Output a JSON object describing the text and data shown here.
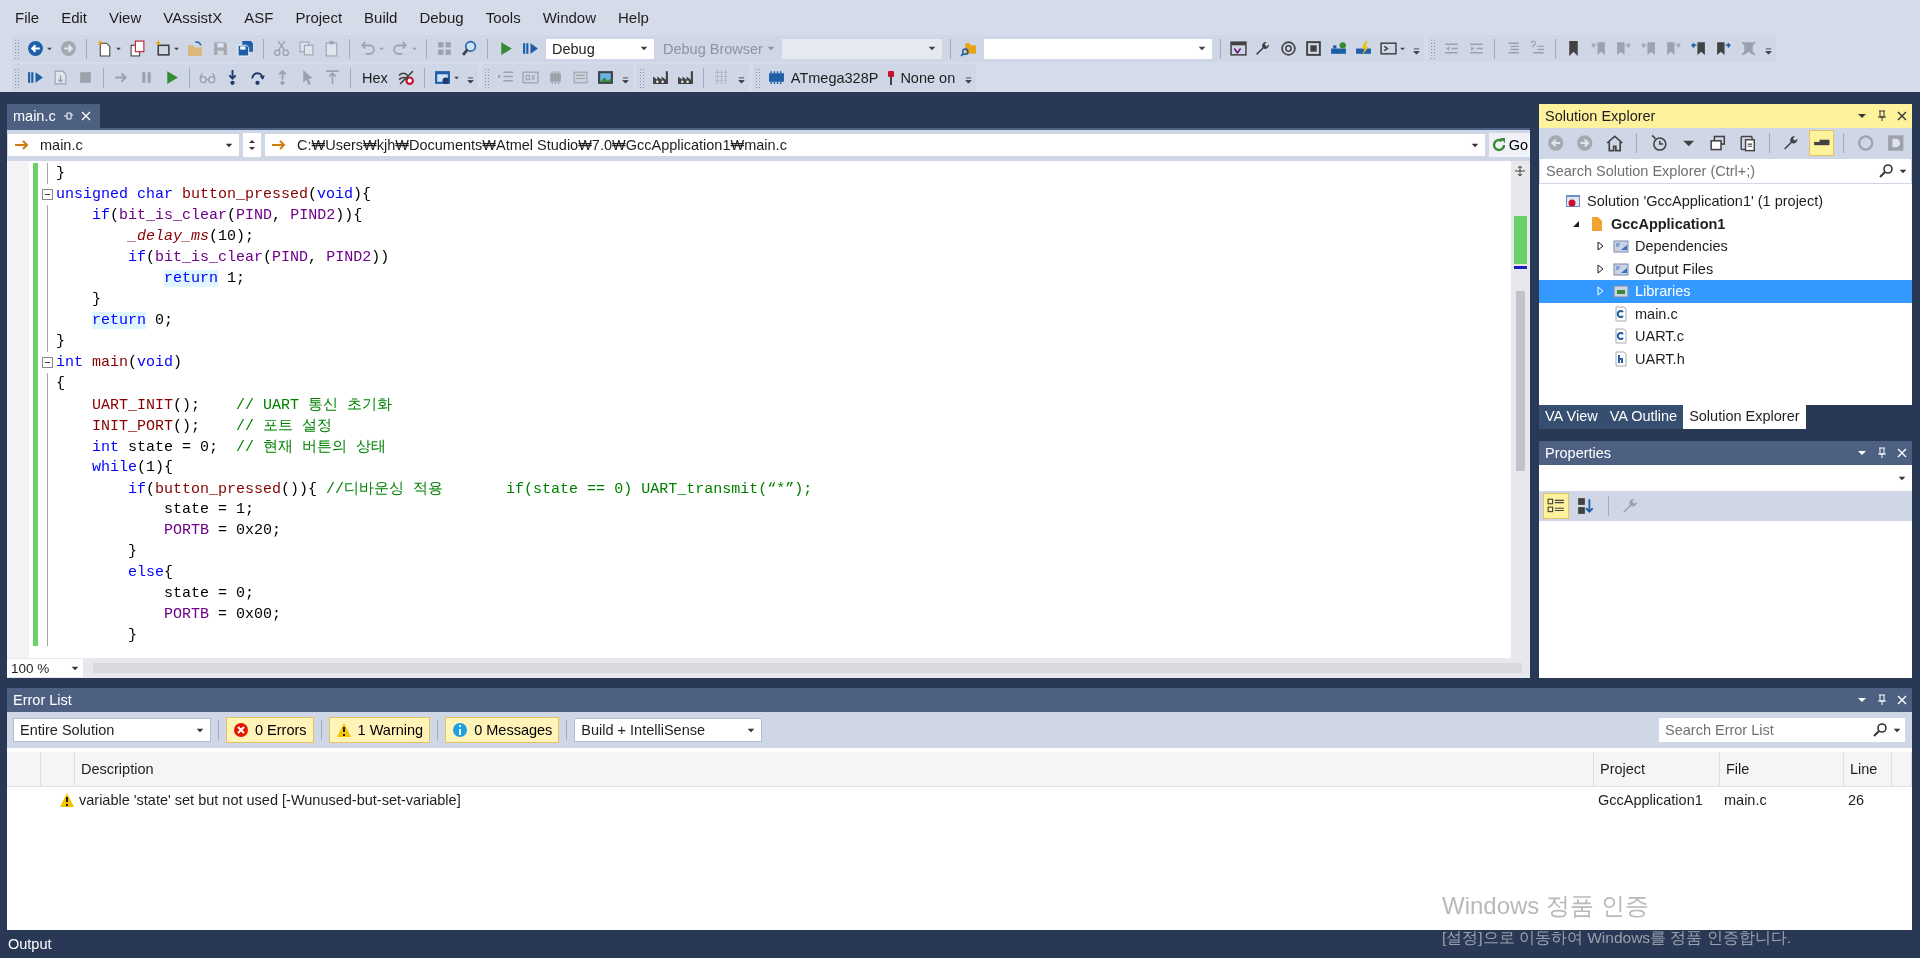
{
  "menu": [
    "File",
    "Edit",
    "View",
    "VAssistX",
    "ASF",
    "Project",
    "Build",
    "Debug",
    "Tools",
    "Window",
    "Help"
  ],
  "toolbars": [
    [
      {
        "items": [
          {
            "kind": "icon",
            "disabled": false
          },
          {
            "kind": "caret",
            "disabled": false
          },
          {
            "kind": "icon",
            "disabled": true
          },
          {
            "kind": "separator"
          },
          {
            "kind": "icon",
            "disabled": false
          },
          {
            "kind": "caret",
            "disabled": false
          },
          {
            "kind": "icon",
            "disabled": false
          },
          {
            "kind": "icon",
            "disabled": false
          },
          {
            "kind": "caret",
            "disabled": false
          },
          {
            "kind": "icon",
            "disabled": false
          },
          {
            "kind": "icon",
            "disabled": true
          },
          {
            "kind": "icon",
            "disabled": false
          },
          {
            "kind": "separator"
          },
          {
            "kind": "icon",
            "disabled": true
          },
          {
            "kind": "icon",
            "disabled": true
          },
          {
            "kind": "icon",
            "disabled": true
          },
          {
            "kind": "separator"
          },
          {
            "kind": "icon",
            "disabled": true
          },
          {
            "kind": "caret",
            "disabled": true
          },
          {
            "kind": "icon",
            "disabled": true
          },
          {
            "kind": "caret",
            "disabled": true
          },
          {
            "kind": "separator"
          },
          {
            "kind": "icon",
            "disabled": true
          },
          {
            "kind": "icon",
            "disabled": false
          },
          {
            "kind": "separator"
          },
          {
            "kind": "icon",
            "disabled": false
          },
          {
            "kind": "icon",
            "disabled": false
          },
          {
            "kind": "combo",
            "value": "Debug",
            "disabled": false
          },
          {
            "kind": "menu-button",
            "label": "Debug Browser",
            "disabled": true
          },
          {
            "kind": "combo",
            "disabled": true
          },
          {
            "kind": "separator"
          },
          {
            "kind": "icon",
            "disabled": false
          },
          {
            "kind": "combo",
            "disabled": false
          },
          {
            "kind": "separator"
          },
          {
            "kind": "icon",
            "disabled": false
          },
          {
            "kind": "icon",
            "disabled": false
          },
          {
            "kind": "icon",
            "disabled": false
          },
          {
            "kind": "icon",
            "disabled": false
          },
          {
            "kind": "icon",
            "disabled": false
          },
          {
            "kind": "icon",
            "disabled": false
          },
          {
            "kind": "icon",
            "disabled": false
          },
          {
            "kind": "caret",
            "disabled": false
          }
        ]
      },
      {
        "items": [
          {
            "kind": "icon",
            "disabled": true
          },
          {
            "kind": "icon",
            "disabled": true
          },
          {
            "kind": "separator"
          },
          {
            "kind": "icon",
            "disabled": true
          },
          {
            "kind": "icon",
            "disabled": true
          },
          {
            "kind": "separator"
          },
          {
            "kind": "icon",
            "disabled": false
          },
          {
            "kind": "icon",
            "disabled": true
          },
          {
            "kind": "icon",
            "disabled": true
          },
          {
            "kind": "icon",
            "disabled": true
          },
          {
            "kind": "icon",
            "disabled": true
          },
          {
            "kind": "icon",
            "disabled": false
          },
          {
            "kind": "icon",
            "disabled": false
          },
          {
            "kind": "icon",
            "disabled": true
          }
        ]
      }
    ],
    [
      {
        "items": [
          {
            "kind": "icon",
            "disabled": false
          },
          {
            "kind": "icon",
            "disabled": true
          },
          {
            "kind": "icon",
            "disabled": true
          },
          {
            "kind": "separator"
          },
          {
            "kind": "icon",
            "disabled": true
          },
          {
            "kind": "icon",
            "disabled": true
          },
          {
            "kind": "icon",
            "disabled": false
          },
          {
            "kind": "separator"
          },
          {
            "kind": "icon",
            "disabled": true
          },
          {
            "kind": "icon",
            "disabled": false
          },
          {
            "kind": "icon",
            "disabled": false
          },
          {
            "kind": "icon",
            "disabled": true
          },
          {
            "kind": "icon",
            "disabled": true
          },
          {
            "kind": "icon",
            "disabled": true
          },
          {
            "kind": "separator"
          },
          {
            "kind": "text-button",
            "label": "Hex",
            "disabled": false
          },
          {
            "kind": "icon",
            "disabled": false
          },
          {
            "kind": "separator"
          },
          {
            "kind": "icon",
            "disabled": false
          },
          {
            "kind": "caret",
            "disabled": false
          }
        ]
      },
      {
        "items": [
          {
            "kind": "icon",
            "disabled": true
          },
          {
            "kind": "icon",
            "disabled": true
          },
          {
            "kind": "icon",
            "disabled": true
          },
          {
            "kind": "icon",
            "disabled": true
          },
          {
            "kind": "icon",
            "disabled": false
          }
        ]
      },
      {
        "items": [
          {
            "kind": "icon",
            "disabled": false
          },
          {
            "kind": "icon",
            "disabled": false
          },
          {
            "kind": "separator"
          },
          {
            "kind": "icon",
            "disabled": true
          }
        ]
      },
      {
        "items": [
          {
            "kind": "device",
            "label": "ATmega328P"
          },
          {
            "kind": "tool",
            "label": "None on"
          }
        ]
      }
    ]
  ],
  "editor": {
    "tabs": [
      {
        "label": "main.c",
        "selected": true
      }
    ],
    "navigation": {
      "scope": "main.c",
      "path": "C:₩Users₩kjh₩Documents₩Atmel Studio₩7.0₩GccApplication1₩main.c",
      "go": "Go"
    },
    "lines": [
      {
        "fold": false,
        "segments": [
          {
            "t": "}"
          }
        ]
      },
      {
        "fold": true,
        "segments": [
          {
            "t": "unsigned char ",
            "color": "#0000ff"
          },
          {
            "t": "button_pressed",
            "color": "#880000"
          },
          {
            "t": "("
          },
          {
            "t": "void",
            "color": "#0000ff"
          },
          {
            "t": "){"
          }
        ]
      },
      {
        "fold": false,
        "segments": [
          {
            "t": "    if",
            "color": "#0000ff"
          },
          {
            "t": "("
          },
          {
            "t": "bit_is_clear",
            "color": "#6f008a"
          },
          {
            "t": "("
          },
          {
            "t": "PIND",
            "color": "#6f008a"
          },
          {
            "t": ", "
          },
          {
            "t": "PIND2",
            "color": "#6f008a"
          },
          {
            "t": ")){"
          }
        ]
      },
      {
        "fold": false,
        "segments": [
          {
            "t": "        *_delay_ms*",
            "color": "#880000"
          },
          {
            "t": "(10);"
          }
        ]
      },
      {
        "fold": false,
        "segments": [
          {
            "t": "        if",
            "color": "#0000ff"
          },
          {
            "t": "("
          },
          {
            "t": "bit_is_clear",
            "color": "#6f008a"
          },
          {
            "t": "("
          },
          {
            "t": "PIND",
            "color": "#6f008a"
          },
          {
            "t": ", "
          },
          {
            "t": "PIND2",
            "color": "#6f008a"
          },
          {
            "t": "))"
          }
        ]
      },
      {
        "fold": false,
        "segments": [
          {
            "t": "            return",
            "color": "#0000ff",
            "highlighted": true
          },
          {
            "t": " 1;"
          }
        ]
      },
      {
        "fold": false,
        "segments": [
          {
            "t": "    }"
          }
        ]
      },
      {
        "fold": false,
        "segments": [
          {
            "t": "    return",
            "color": "#0000ff",
            "highlighted": true
          },
          {
            "t": " 0;"
          }
        ]
      },
      {
        "fold": false,
        "segments": [
          {
            "t": "}"
          }
        ]
      },
      {
        "fold": true,
        "segments": [
          {
            "t": "int ",
            "color": "#0000ff"
          },
          {
            "t": "main",
            "color": "#880000"
          },
          {
            "t": "("
          },
          {
            "t": "void",
            "color": "#0000ff"
          },
          {
            "t": ")"
          }
        ]
      },
      {
        "fold": false,
        "segments": [
          {
            "t": "{"
          }
        ]
      },
      {
        "fold": false,
        "segments": [
          {
            "t": "    UART_INIT",
            "color": "#880000"
          },
          {
            "t": "();    "
          },
          {
            "t": "// UART 통신 초기화",
            "color": "#008000"
          }
        ]
      },
      {
        "fold": false,
        "segments": [
          {
            "t": "    INIT_PORT",
            "color": "#880000"
          },
          {
            "t": "();    "
          },
          {
            "t": "// 포트 설정",
            "color": "#008000"
          }
        ]
      },
      {
        "fold": false,
        "segments": [
          {
            "t": "    int",
            "color": "#0000ff"
          },
          {
            "t": " state = 0;  "
          },
          {
            "t": "// 현재 버튼의 상태",
            "color": "#008000"
          }
        ]
      },
      {
        "fold": false,
        "segments": [
          {
            "t": "    while",
            "color": "#0000ff"
          },
          {
            "t": "(1){"
          }
        ]
      },
      {
        "fold": false,
        "segments": [
          {
            "t": "        if",
            "color": "#0000ff"
          },
          {
            "t": "("
          },
          {
            "t": "button_pressed",
            "color": "#880000"
          },
          {
            "t": "()){ "
          },
          {
            "t": "//디바운싱 적용       if(state == 0) UART_transmit(“*”);",
            "color": "#008000"
          }
        ]
      },
      {
        "fold": false,
        "segments": [
          {
            "t": "            state = 1;"
          }
        ]
      },
      {
        "fold": false,
        "segments": [
          {
            "t": "            PORTB",
            "color": "#6f008a"
          },
          {
            "t": " = 0x20;"
          }
        ]
      },
      {
        "fold": false,
        "segments": [
          {
            "t": "        }"
          }
        ]
      },
      {
        "fold": false,
        "segments": [
          {
            "t": "        else",
            "color": "#0000ff"
          },
          {
            "t": "{"
          }
        ]
      },
      {
        "fold": false,
        "segments": [
          {
            "t": "            state = 0;"
          }
        ]
      },
      {
        "fold": false,
        "segments": [
          {
            "t": "            PORTB",
            "color": "#6f008a"
          },
          {
            "t": " = 0x00;"
          }
        ]
      },
      {
        "fold": false,
        "segments": [
          {
            "t": "        }"
          }
        ]
      }
    ],
    "zoom": "100 %"
  },
  "solution_explorer": {
    "title": "Solution Explorer",
    "active": true,
    "toolbar": [
      {
        "disabled": true,
        "selected": false
      },
      {
        "disabled": true,
        "selected": false
      },
      {
        "disabled": false,
        "selected": false
      },
      {
        "disabled": false,
        "selected": false
      },
      {
        "disabled": false,
        "selected": false
      },
      {
        "disabled": false,
        "selected": false
      },
      {
        "disabled": false,
        "selected": false
      },
      {
        "disabled": false,
        "selected": false
      },
      {
        "disabled": false,
        "selected": true
      },
      {
        "disabled": true,
        "selected": false
      },
      {
        "disabled": true,
        "selected": false
      }
    ],
    "search": {
      "placeholder": "Search Solution Explorer (Ctrl+;)"
    },
    "tree": [
      {
        "label": "Solution 'GccApplication1' (1 project)",
        "kind": "solution",
        "selected": false,
        "children": [
          {
            "label": "GccApplication1",
            "kind": "project",
            "expanded": true,
            "selected": false,
            "children": [
              {
                "label": "Dependencies",
                "kind": "folder",
                "expanded": false,
                "selected": false
              },
              {
                "label": "Output Files",
                "kind": "folder",
                "expanded": false,
                "selected": false
              },
              {
                "label": "Libraries",
                "kind": "library",
                "expanded": false,
                "selected": true
              },
              {
                "label": "main.c",
                "kind": "c-file",
                "selected": false
              },
              {
                "label": "UART.c",
                "kind": "c-file",
                "selected": false
              },
              {
                "label": "UART.h",
                "kind": "h-file",
                "selected": false
              }
            ]
          }
        ]
      }
    ],
    "tabs": [
      {
        "label": "VA View",
        "selected": false
      },
      {
        "label": "VA Outline",
        "selected": false
      },
      {
        "label": "Solution Explorer",
        "selected": true
      }
    ]
  },
  "properties": {
    "title": "Properties",
    "active": false,
    "toolbar": [
      {
        "disabled": false,
        "selected": true
      },
      {
        "disabled": false,
        "selected": false
      },
      {
        "disabled": true,
        "selected": false
      }
    ]
  },
  "error_list": {
    "title": "Error List",
    "active": false,
    "scope": "Entire Solution",
    "filters": [
      {
        "kind": "error",
        "label": "0 Errors",
        "selected": true
      },
      {
        "kind": "warning",
        "label": "1 Warning",
        "selected": true
      },
      {
        "kind": "message",
        "label": "0 Messages",
        "selected": true
      }
    ],
    "source": "Build + IntelliSense",
    "search": {
      "placeholder": "Search Error List"
    },
    "columns": [
      "Description",
      "Project",
      "File",
      "Line"
    ],
    "rows": [
      {
        "kind": "warning",
        "description": "variable 'state' set but not used [-Wunused-but-set-variable]",
        "project": "GccApplication1",
        "file": "main.c",
        "line": "26"
      }
    ]
  },
  "status_bar": {
    "tab": "Output"
  },
  "activation_notice": {
    "title": "Windows 정품 인증",
    "message": "[설정]으로 이동하여 Windows를 정품 인증합니다."
  }
}
